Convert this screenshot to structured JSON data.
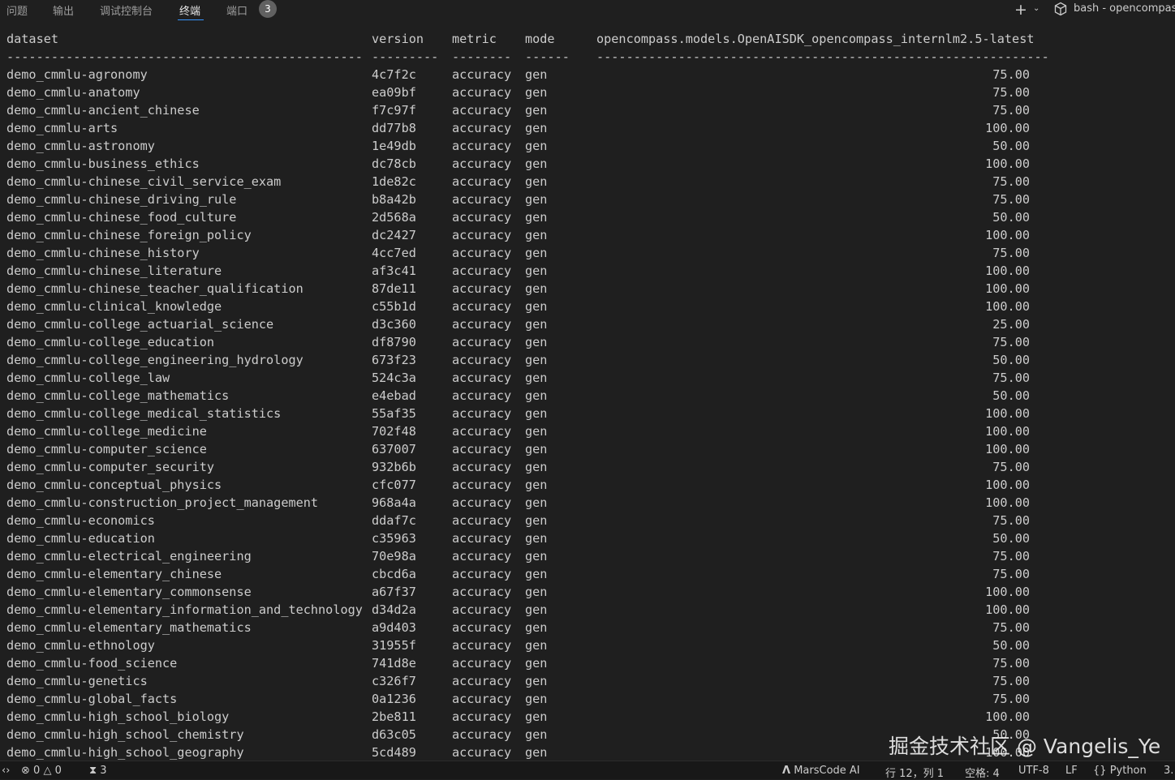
{
  "panel_tabs": [
    {
      "label": "问题"
    },
    {
      "label": "输出"
    },
    {
      "label": "调试控制台"
    },
    {
      "label": "终端"
    },
    {
      "label": "端口"
    }
  ],
  "ports_badge": "3",
  "shell": {
    "name": "bash - opencompass",
    "new_terminal_icon": "plus-icon",
    "dropdown_icon": "chevron-down-icon",
    "terminal_icon": "cube-icon"
  },
  "terminal": {
    "header": {
      "dataset": "dataset",
      "version": "version",
      "metric": "metric",
      "mode": "mode",
      "model": "opencompass.models.OpenAISDK_opencompass_internlm2.5-latest"
    },
    "separator": {
      "dataset": "------------------------------------------------",
      "version": "---------",
      "metric": "--------",
      "mode": "------",
      "model": "-------------------------------------------------------------"
    },
    "rows": [
      {
        "dataset": "demo_cmmlu-agronomy",
        "version": "4c7f2c",
        "metric": "accuracy",
        "mode": "gen",
        "score": "75.00"
      },
      {
        "dataset": "demo_cmmlu-anatomy",
        "version": "ea09bf",
        "metric": "accuracy",
        "mode": "gen",
        "score": "75.00"
      },
      {
        "dataset": "demo_cmmlu-ancient_chinese",
        "version": "f7c97f",
        "metric": "accuracy",
        "mode": "gen",
        "score": "75.00"
      },
      {
        "dataset": "demo_cmmlu-arts",
        "version": "dd77b8",
        "metric": "accuracy",
        "mode": "gen",
        "score": "100.00"
      },
      {
        "dataset": "demo_cmmlu-astronomy",
        "version": "1e49db",
        "metric": "accuracy",
        "mode": "gen",
        "score": "50.00"
      },
      {
        "dataset": "demo_cmmlu-business_ethics",
        "version": "dc78cb",
        "metric": "accuracy",
        "mode": "gen",
        "score": "100.00"
      },
      {
        "dataset": "demo_cmmlu-chinese_civil_service_exam",
        "version": "1de82c",
        "metric": "accuracy",
        "mode": "gen",
        "score": "75.00"
      },
      {
        "dataset": "demo_cmmlu-chinese_driving_rule",
        "version": "b8a42b",
        "metric": "accuracy",
        "mode": "gen",
        "score": "75.00"
      },
      {
        "dataset": "demo_cmmlu-chinese_food_culture",
        "version": "2d568a",
        "metric": "accuracy",
        "mode": "gen",
        "score": "50.00"
      },
      {
        "dataset": "demo_cmmlu-chinese_foreign_policy",
        "version": "dc2427",
        "metric": "accuracy",
        "mode": "gen",
        "score": "100.00"
      },
      {
        "dataset": "demo_cmmlu-chinese_history",
        "version": "4cc7ed",
        "metric": "accuracy",
        "mode": "gen",
        "score": "75.00"
      },
      {
        "dataset": "demo_cmmlu-chinese_literature",
        "version": "af3c41",
        "metric": "accuracy",
        "mode": "gen",
        "score": "100.00"
      },
      {
        "dataset": "demo_cmmlu-chinese_teacher_qualification",
        "version": "87de11",
        "metric": "accuracy",
        "mode": "gen",
        "score": "100.00"
      },
      {
        "dataset": "demo_cmmlu-clinical_knowledge",
        "version": "c55b1d",
        "metric": "accuracy",
        "mode": "gen",
        "score": "100.00"
      },
      {
        "dataset": "demo_cmmlu-college_actuarial_science",
        "version": "d3c360",
        "metric": "accuracy",
        "mode": "gen",
        "score": "25.00"
      },
      {
        "dataset": "demo_cmmlu-college_education",
        "version": "df8790",
        "metric": "accuracy",
        "mode": "gen",
        "score": "75.00"
      },
      {
        "dataset": "demo_cmmlu-college_engineering_hydrology",
        "version": "673f23",
        "metric": "accuracy",
        "mode": "gen",
        "score": "50.00"
      },
      {
        "dataset": "demo_cmmlu-college_law",
        "version": "524c3a",
        "metric": "accuracy",
        "mode": "gen",
        "score": "75.00"
      },
      {
        "dataset": "demo_cmmlu-college_mathematics",
        "version": "e4ebad",
        "metric": "accuracy",
        "mode": "gen",
        "score": "50.00"
      },
      {
        "dataset": "demo_cmmlu-college_medical_statistics",
        "version": "55af35",
        "metric": "accuracy",
        "mode": "gen",
        "score": "100.00"
      },
      {
        "dataset": "demo_cmmlu-college_medicine",
        "version": "702f48",
        "metric": "accuracy",
        "mode": "gen",
        "score": "100.00"
      },
      {
        "dataset": "demo_cmmlu-computer_science",
        "version": "637007",
        "metric": "accuracy",
        "mode": "gen",
        "score": "100.00"
      },
      {
        "dataset": "demo_cmmlu-computer_security",
        "version": "932b6b",
        "metric": "accuracy",
        "mode": "gen",
        "score": "75.00"
      },
      {
        "dataset": "demo_cmmlu-conceptual_physics",
        "version": "cfc077",
        "metric": "accuracy",
        "mode": "gen",
        "score": "100.00"
      },
      {
        "dataset": "demo_cmmlu-construction_project_management",
        "version": "968a4a",
        "metric": "accuracy",
        "mode": "gen",
        "score": "100.00"
      },
      {
        "dataset": "demo_cmmlu-economics",
        "version": "ddaf7c",
        "metric": "accuracy",
        "mode": "gen",
        "score": "75.00"
      },
      {
        "dataset": "demo_cmmlu-education",
        "version": "c35963",
        "metric": "accuracy",
        "mode": "gen",
        "score": "50.00"
      },
      {
        "dataset": "demo_cmmlu-electrical_engineering",
        "version": "70e98a",
        "metric": "accuracy",
        "mode": "gen",
        "score": "75.00"
      },
      {
        "dataset": "demo_cmmlu-elementary_chinese",
        "version": "cbcd6a",
        "metric": "accuracy",
        "mode": "gen",
        "score": "75.00"
      },
      {
        "dataset": "demo_cmmlu-elementary_commonsense",
        "version": "a67f37",
        "metric": "accuracy",
        "mode": "gen",
        "score": "100.00"
      },
      {
        "dataset": "demo_cmmlu-elementary_information_and_technology",
        "version": "d34d2a",
        "metric": "accuracy",
        "mode": "gen",
        "score": "100.00"
      },
      {
        "dataset": "demo_cmmlu-elementary_mathematics",
        "version": "a9d403",
        "metric": "accuracy",
        "mode": "gen",
        "score": "75.00"
      },
      {
        "dataset": "demo_cmmlu-ethnology",
        "version": "31955f",
        "metric": "accuracy",
        "mode": "gen",
        "score": "50.00"
      },
      {
        "dataset": "demo_cmmlu-food_science",
        "version": "741d8e",
        "metric": "accuracy",
        "mode": "gen",
        "score": "75.00"
      },
      {
        "dataset": "demo_cmmlu-genetics",
        "version": "c326f7",
        "metric": "accuracy",
        "mode": "gen",
        "score": "75.00"
      },
      {
        "dataset": "demo_cmmlu-global_facts",
        "version": "0a1236",
        "metric": "accuracy",
        "mode": "gen",
        "score": "75.00"
      },
      {
        "dataset": "demo_cmmlu-high_school_biology",
        "version": "2be811",
        "metric": "accuracy",
        "mode": "gen",
        "score": "100.00"
      },
      {
        "dataset": "demo_cmmlu-high_school_chemistry",
        "version": "d63c05",
        "metric": "accuracy",
        "mode": "gen",
        "score": "50.00"
      },
      {
        "dataset": "demo_cmmlu-high_school_geography",
        "version": "5cd489",
        "metric": "accuracy",
        "mode": "gen",
        "score": "100.00"
      }
    ]
  },
  "watermark": "掘金技术社区 @ Vangelis_Ye",
  "statusbar": {
    "errors": "0",
    "warnings": "0",
    "ports": "3",
    "marscode": "MarsCode AI",
    "cursor": "行 12，列 1",
    "spaces": "空格: 4",
    "encoding": "UTF-8",
    "eol": "LF",
    "language": "Python",
    "version": "3."
  }
}
